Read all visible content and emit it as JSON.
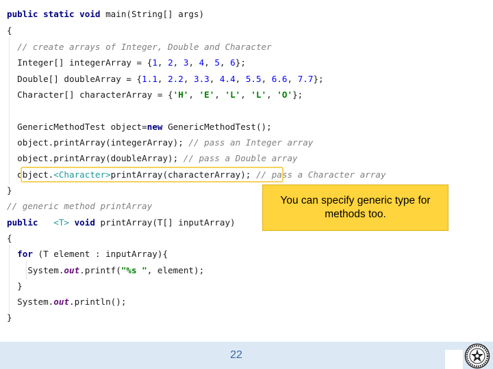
{
  "code": {
    "main_signature_kw": "public static void",
    "main_signature_rest": " main(String[] args)",
    "open_brace": "{",
    "comment_create": "// create arrays of Integer, Double and Character",
    "int_decl": "Integer[] integerArray = {",
    "int_vals": [
      "1",
      "2",
      "3",
      "4",
      "5",
      "6"
    ],
    "int_end": "};",
    "dbl_decl": "Double[] doubleArray = {",
    "dbl_vals": [
      "1.1",
      "2.2",
      "3.3",
      "4.4",
      "5.5",
      "6.6",
      "7.7"
    ],
    "dbl_end": "};",
    "chr_decl": "Character[] characterArray = {",
    "chr_vals": [
      "'H'",
      "'E'",
      "'L'",
      "'L'",
      "'O'"
    ],
    "chr_end": "};",
    "obj_decl_a": "GenericMethodTest object=",
    "obj_new_kw": "new",
    "obj_decl_b": " GenericMethodTest();",
    "call_int": "object.printArray(integerArray);",
    "comment_int": " // pass an Integer array",
    "call_dbl": "object.printArray(doubleArray);",
    "comment_dbl": " // pass a Double array",
    "call_chr_prefix": "object.",
    "call_chr_generic": "<Character>",
    "call_chr_rest": "printArray(characterArray)",
    "call_chr_end": ";",
    "comment_chr": " // pass a Character array",
    "close_brace": "}",
    "comment_generic": "// generic method printArray",
    "method_kw": "public",
    "method_generic": "   <T>",
    "method_void_kw": " void",
    "method_rest": " printArray(T[] inputArray)",
    "for_kw": "for",
    "for_rest": " (T element : inputArray){",
    "printf_a": "System.",
    "printf_out": "out",
    "printf_b": ".printf(",
    "printf_str": "\"%s \"",
    "printf_c": ", element);",
    "inner_close": "}",
    "println_a": "System.",
    "println_out": "out",
    "println_b": ".println();",
    "final_close": "}"
  },
  "callout": {
    "text": "You can specify generic type for methods too."
  },
  "footer": {
    "page_number": "22",
    "emblem_icon": "university-seal-icon"
  },
  "colors": {
    "callout_bg": "#ffd43d",
    "highlight_border": "#f5d25a",
    "footer_bg": "#dce9f5",
    "keyword": "#000080"
  }
}
